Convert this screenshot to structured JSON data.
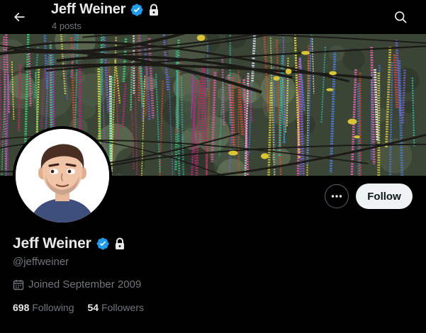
{
  "header": {
    "name": "Jeff Weiner",
    "posts": "4 posts",
    "back_icon": "arrow-left-icon",
    "search_icon": "search-icon"
  },
  "banner": {
    "description_colors": [
      "#c2238a",
      "#2fb3a0",
      "#e8d53a",
      "#7b5fd0",
      "#d94a2c"
    ]
  },
  "profile": {
    "name": "Jeff Weiner",
    "handle": "@jeffweiner",
    "joined": "Joined September 2009",
    "following_count": "698",
    "following_label": "Following",
    "followers_count": "54",
    "followers_label": "Followers"
  },
  "actions": {
    "follow_label": "Follow",
    "more_icon": "more-icon"
  },
  "colors": {
    "background": "#000000",
    "text": "#e7e9ea",
    "secondary": "#71767b",
    "verified": "#1d9bf0",
    "button": "#eff3f4"
  }
}
